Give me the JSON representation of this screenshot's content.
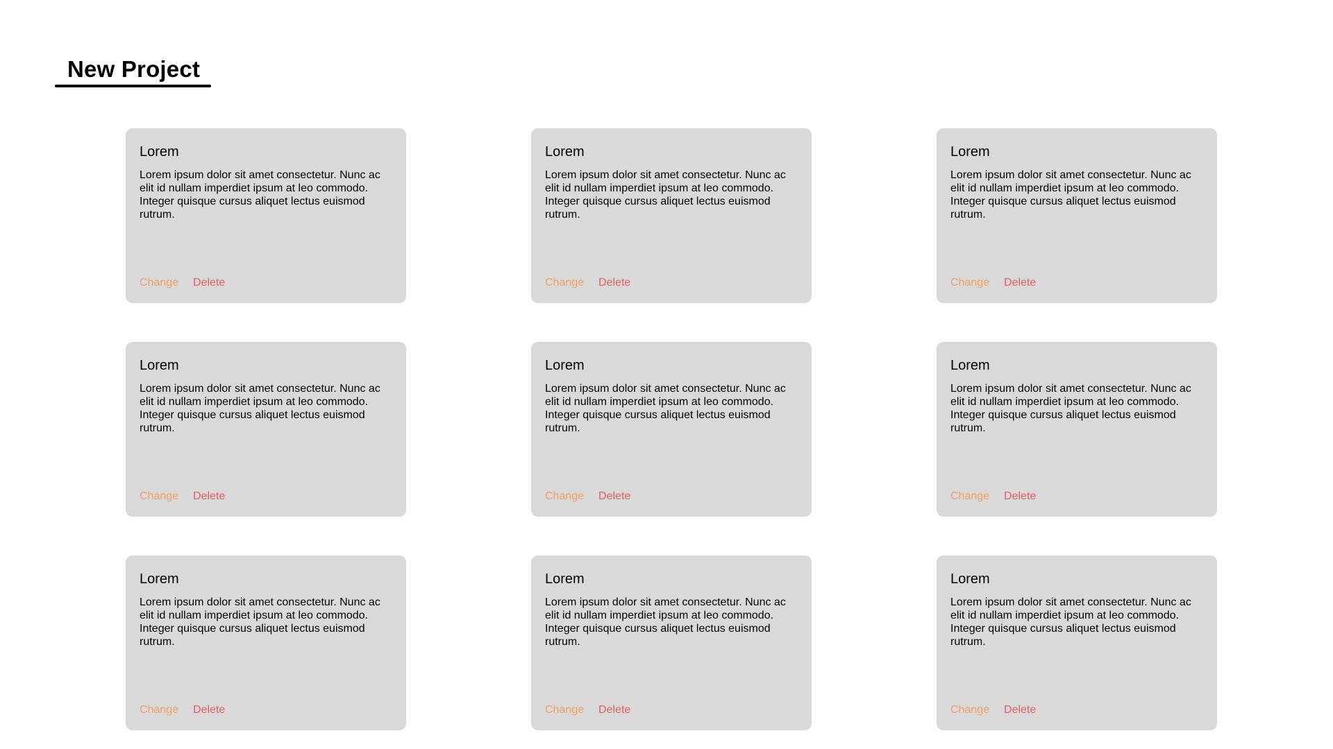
{
  "header": {
    "title": "New Project"
  },
  "colors": {
    "card_background": "#d9d9d9",
    "change_action": "#f29c5f",
    "delete_action": "#eb5a57"
  },
  "cards": [
    {
      "title": "Lorem",
      "body": "Lorem ipsum dolor sit amet consectetur. Nunc ac elit id nullam imperdiet ipsum at leo commodo. Integer quisque cursus aliquet lectus euismod rutrum.",
      "change_label": "Change",
      "delete_label": "Delete"
    },
    {
      "title": "Lorem",
      "body": "Lorem ipsum dolor sit amet consectetur. Nunc ac elit id nullam imperdiet ipsum at leo commodo. Integer quisque cursus aliquet lectus euismod rutrum.",
      "change_label": "Change",
      "delete_label": "Delete"
    },
    {
      "title": "Lorem",
      "body": "Lorem ipsum dolor sit amet consectetur. Nunc ac elit id nullam imperdiet ipsum at leo commodo. Integer quisque cursus aliquet lectus euismod rutrum.",
      "change_label": "Change",
      "delete_label": "Delete"
    },
    {
      "title": "Lorem",
      "body": "Lorem ipsum dolor sit amet consectetur. Nunc ac elit id nullam imperdiet ipsum at leo commodo. Integer quisque cursus aliquet lectus euismod rutrum.",
      "change_label": "Change",
      "delete_label": "Delete"
    },
    {
      "title": "Lorem",
      "body": "Lorem ipsum dolor sit amet consectetur. Nunc ac elit id nullam imperdiet ipsum at leo commodo. Integer quisque cursus aliquet lectus euismod rutrum.",
      "change_label": "Change",
      "delete_label": "Delete"
    },
    {
      "title": "Lorem",
      "body": "Lorem ipsum dolor sit amet consectetur. Nunc ac elit id nullam imperdiet ipsum at leo commodo. Integer quisque cursus aliquet lectus euismod rutrum.",
      "change_label": "Change",
      "delete_label": "Delete"
    },
    {
      "title": "Lorem",
      "body": "Lorem ipsum dolor sit amet consectetur. Nunc ac elit id nullam imperdiet ipsum at leo commodo. Integer quisque cursus aliquet lectus euismod rutrum.",
      "change_label": "Change",
      "delete_label": "Delete"
    },
    {
      "title": "Lorem",
      "body": "Lorem ipsum dolor sit amet consectetur. Nunc ac elit id nullam imperdiet ipsum at leo commodo. Integer quisque cursus aliquet lectus euismod rutrum.",
      "change_label": "Change",
      "delete_label": "Delete"
    },
    {
      "title": "Lorem",
      "body": "Lorem ipsum dolor sit amet consectetur. Nunc ac elit id nullam imperdiet ipsum at leo commodo. Integer quisque cursus aliquet lectus euismod rutrum.",
      "change_label": "Change",
      "delete_label": "Delete"
    }
  ]
}
